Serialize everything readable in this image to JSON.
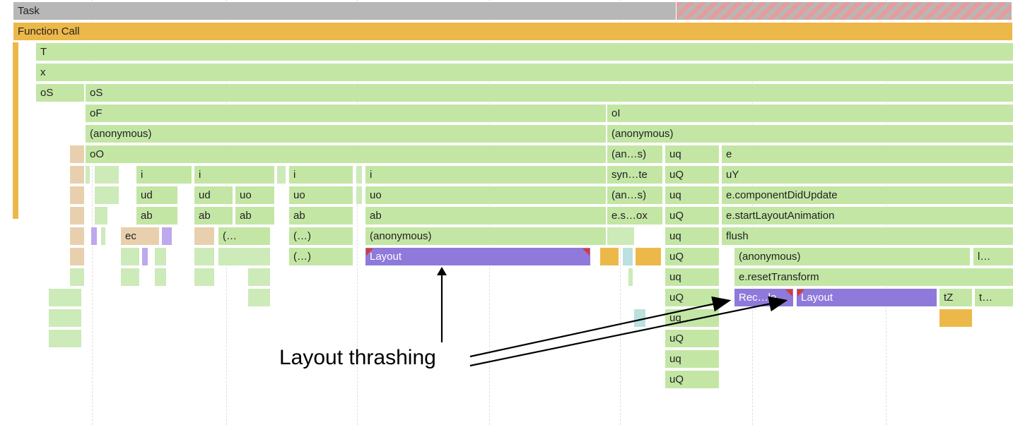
{
  "taskBar": {
    "label": "Task"
  },
  "funcCall": {
    "label": "Function Call"
  },
  "rows": {
    "r2": {
      "T": "T"
    },
    "r3": {
      "x": "x"
    },
    "r4": {
      "oS1": "oS",
      "oS2": "oS"
    },
    "r5": {
      "oF": "oF",
      "oI": "oI"
    },
    "r6": {
      "anon1": "(anonymous)",
      "anon2": "(anonymous)"
    },
    "r7": {
      "oO": "oO",
      "ans": "(an…s)",
      "uq": "uq",
      "e": "e"
    },
    "r8": {
      "i1": "i",
      "i2": "i",
      "i3": "i",
      "i4": "i",
      "synte": "syn…te",
      "uQ": "uQ",
      "uY": "uY"
    },
    "r9": {
      "ud1": "ud",
      "ud2": "ud",
      "uo1": "uo",
      "uo2": "uo",
      "uo3": "uo",
      "ans": "(an…s)",
      "uq": "uq",
      "ecdu": "e.componentDidUpdate"
    },
    "r10": {
      "ab1": "ab",
      "ab2": "ab",
      "ab3": "ab",
      "ab4": "ab",
      "ab5": "ab",
      "esox": "e.s…ox",
      "uQ": "uQ",
      "esla": "e.startLayoutAnimation"
    },
    "r11": {
      "ec": "ec",
      "p1": "(…",
      "p2": "(…)",
      "anon": "(anonymous)",
      "uq": "uq",
      "flush": "flush"
    },
    "r12": {
      "p": "(…)",
      "layout": "Layout",
      "uQ": "uQ",
      "anon": "(anonymous)",
      "ltrunc": "l…"
    },
    "r13": {
      "uq": "uq",
      "ert": "e.resetTransform"
    },
    "r14": {
      "uQ": "uQ",
      "rec": "Rec…le",
      "layout": "Layout",
      "tZ": "tZ",
      "t": "t…"
    },
    "r15": {
      "uq": "uq"
    },
    "r16": {
      "uQ": "uQ"
    },
    "r17": {
      "uq": "uq"
    },
    "r18": {
      "uQ": "uQ"
    }
  },
  "annotation": {
    "text": "Layout thrashing"
  }
}
